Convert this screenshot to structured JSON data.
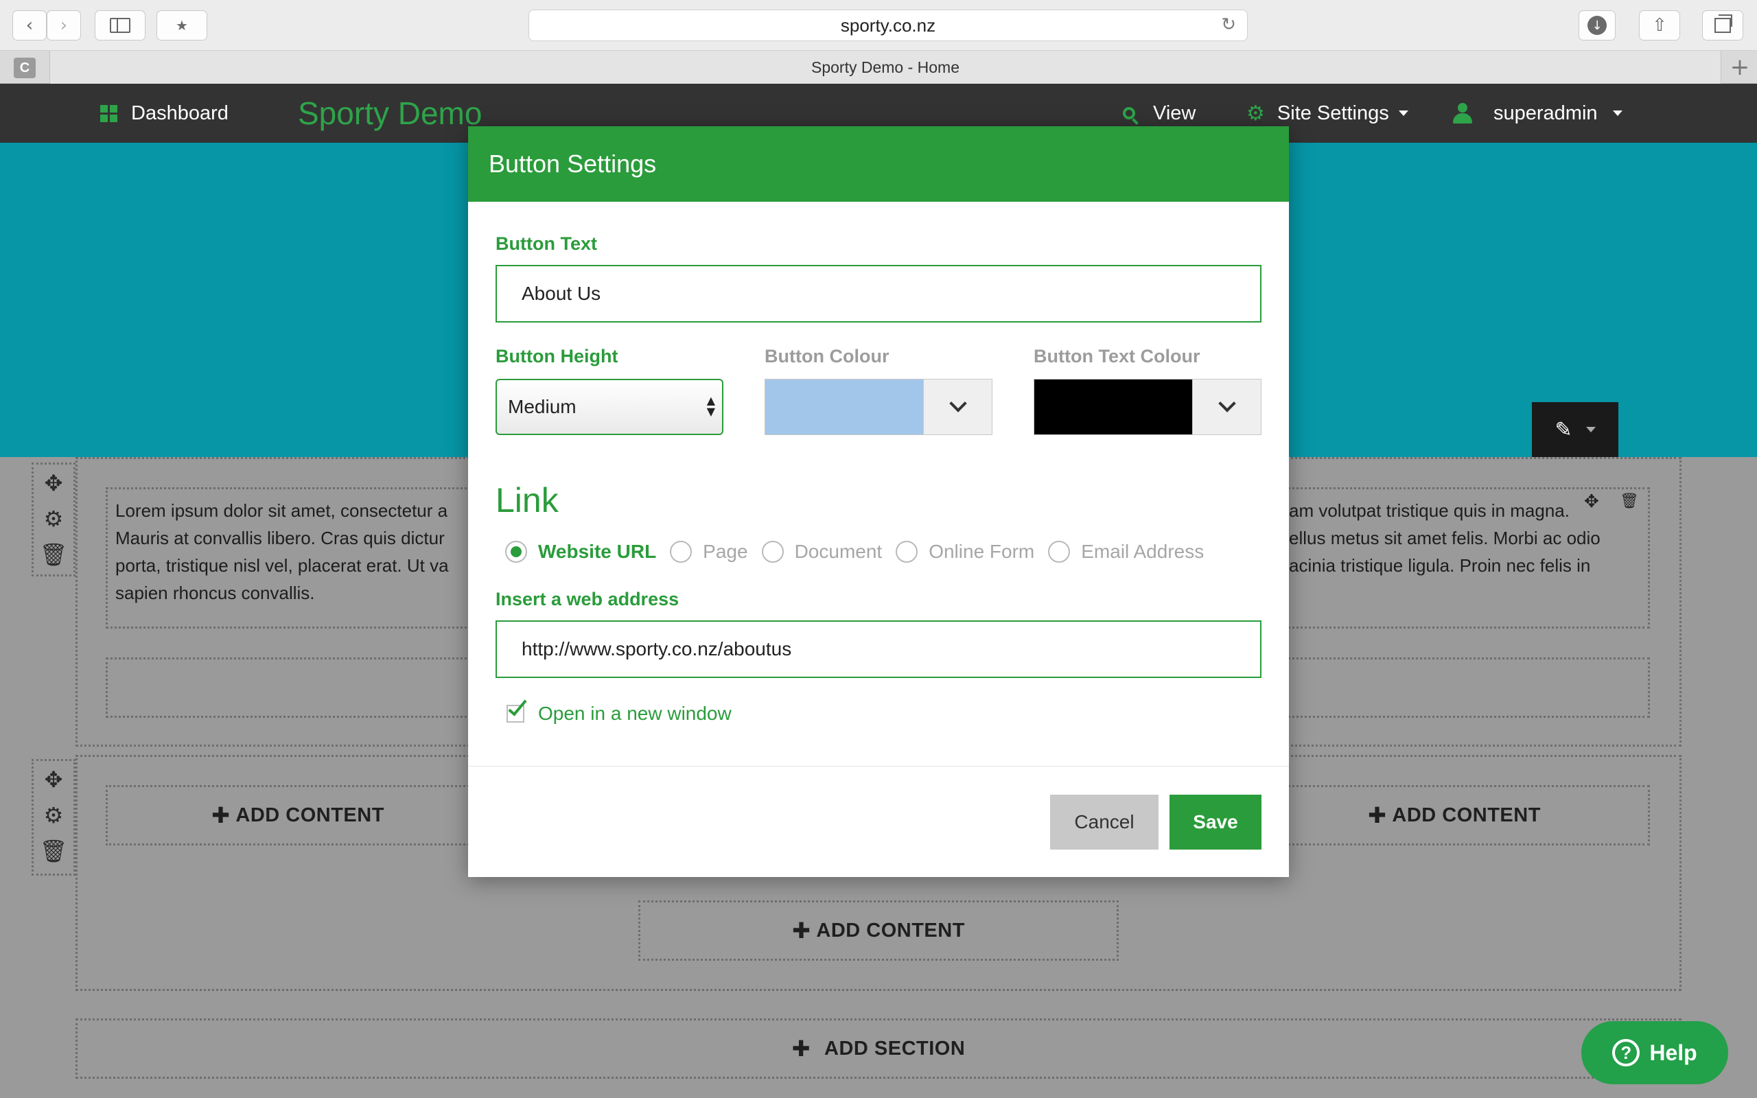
{
  "browser": {
    "url": "sporty.co.nz",
    "tab_title": "Sporty Demo - Home",
    "tab_favicon_letter": "C",
    "new_tab_symbol": "+"
  },
  "sitenav": {
    "dashboard_label": "Dashboard",
    "brand": "Sporty Demo",
    "view_label": "View",
    "site_settings_label": "Site Settings",
    "user_label": "superadmin"
  },
  "page": {
    "lorem_left": "Lorem ipsum dolor sit amet, consectetur a\nMauris at convallis libero. Cras quis dictur\nporta, tristique nisl vel, placerat erat. Ut va\nsapien rhoncus convallis.",
    "lorem_right": "am volutpat tristique quis in magna.\nellus metus sit amet felis. Morbi ac odio\nacinia tristique ligula. Proin nec felis in",
    "add_content_label": "ADD CONTENT",
    "add_section_label": "ADD SECTION"
  },
  "modal": {
    "title": "Button Settings",
    "button_text_label": "Button Text",
    "button_text_value": "About Us",
    "button_height_label": "Button Height",
    "button_height_value": "Medium",
    "button_colour_label": "Button Colour",
    "button_colour_value": "#a2c6ea",
    "button_text_colour_label": "Button Text Colour",
    "button_text_colour_value": "#000000",
    "link_heading": "Link",
    "link_options": [
      {
        "label": "Website URL",
        "selected": true
      },
      {
        "label": "Page",
        "selected": false
      },
      {
        "label": "Document",
        "selected": false
      },
      {
        "label": "Online Form",
        "selected": false
      },
      {
        "label": "Email Address",
        "selected": false
      }
    ],
    "web_address_label": "Insert a web address",
    "web_address_value": "http://www.sporty.co.nz/aboutus",
    "new_window_label": "Open in a new window",
    "new_window_checked": true,
    "cancel_label": "Cancel",
    "save_label": "Save"
  },
  "help": {
    "label": "Help",
    "icon_glyph": "?"
  },
  "colors": {
    "brand_green": "#2a9c3b",
    "hero_teal": "#0696a6",
    "nav_dark": "#333333"
  }
}
